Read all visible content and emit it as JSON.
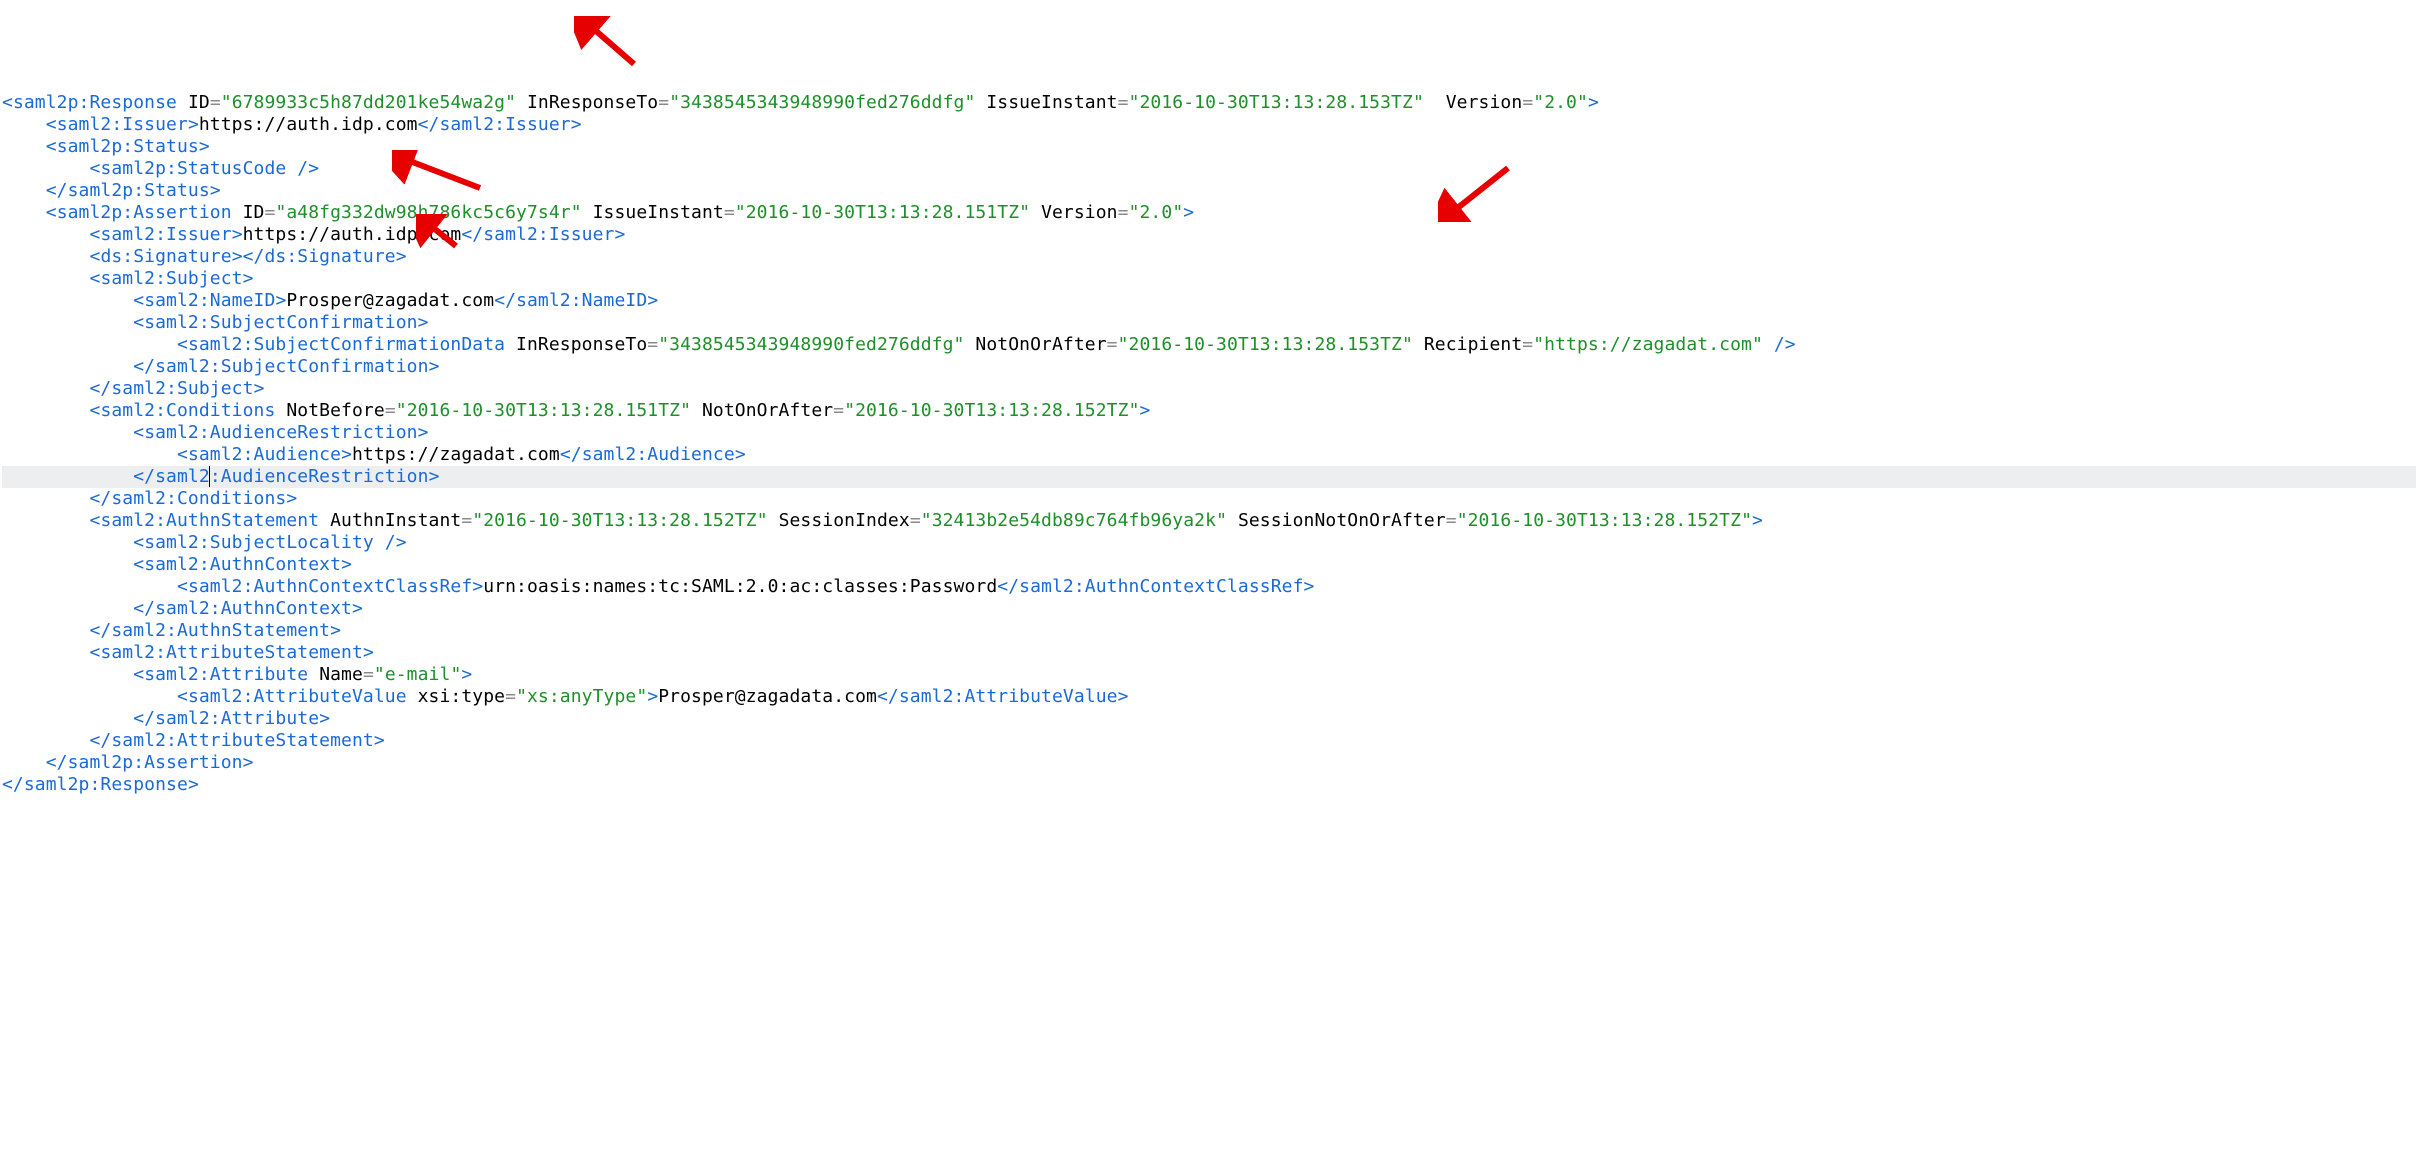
{
  "response": {
    "tag": "saml2p:Response",
    "id": "6789933c5h87dd201ke54wa2g",
    "inResponseTo": "3438545343948990fed276ddfg",
    "issueInstant": "2016-10-30T13:13:28.153TZ",
    "version": "2.0"
  },
  "issuer1": {
    "tag": "saml2:Issuer",
    "text": "https://auth.idp.com"
  },
  "status": {
    "tag": "saml2p:Status",
    "code": "saml2p:StatusCode"
  },
  "assertion": {
    "tag": "saml2p:Assertion",
    "id": "a48fg332dw98h786kc5c6y7s4r",
    "issueInstant": "2016-10-30T13:13:28.151TZ",
    "version": "2.0"
  },
  "issuer2": {
    "tag": "saml2:Issuer",
    "text": "https://auth.idp.com"
  },
  "signature": {
    "tag": "ds:Signature"
  },
  "subject": {
    "tag": "saml2:Subject"
  },
  "nameId": {
    "tag": "saml2:NameID",
    "text": "Prosper@zagadat.com"
  },
  "subjConf": {
    "tag": "saml2:SubjectConfirmation"
  },
  "subjConfData": {
    "tag": "saml2:SubjectConfirmationData",
    "inResponseTo": "3438545343948990fed276ddfg",
    "notOnOrAfter": "2016-10-30T13:13:28.153TZ",
    "recipient": "https://zagadat.com"
  },
  "conditions": {
    "tag": "saml2:Conditions",
    "notBefore": "2016-10-30T13:13:28.151TZ",
    "notOnOrAfter": "2016-10-30T13:13:28.152TZ"
  },
  "audRestr": {
    "tag": "saml2:AudienceRestriction"
  },
  "audience": {
    "tag": "saml2:Audience",
    "text": "https://zagadat.com"
  },
  "audRestrClose": "saml2",
  "audRestrCloseTail": ":AudienceRestriction",
  "authnStmt": {
    "tag": "saml2:AuthnStatement",
    "authnInstant": "2016-10-30T13:13:28.152TZ",
    "sessionIndex": "32413b2e54db89c764fb96ya2k",
    "sessionNotOnOrAfter": "2016-10-30T13:13:28.152TZ"
  },
  "subjLoc": {
    "tag": "saml2:SubjectLocality"
  },
  "authnCtx": {
    "tag": "saml2:AuthnContext"
  },
  "authnCtxClassRef": {
    "tag": "saml2:AuthnContextClassRef",
    "text": "urn:oasis:names:tc:SAML:2.0:ac:classes:Password"
  },
  "attrStmt": {
    "tag": "saml2:AttributeStatement"
  },
  "attribute": {
    "tag": "saml2:Attribute",
    "name": "e-mail"
  },
  "attrValue": {
    "tag": "saml2:AttributeValue",
    "typeAttr": "xsi:type",
    "typeVal": "xs:anyType",
    "text": "Prosper@zagadata.com"
  },
  "labels": {
    "ID": "ID",
    "InResponseTo": "InResponseTo",
    "IssueInstant": "IssueInstant",
    "Version": "Version",
    "NotOnOrAfter": "NotOnOrAfter",
    "Recipient": "Recipient",
    "NotBefore": "NotBefore",
    "AuthnInstant": "AuthnInstant",
    "SessionIndex": "SessionIndex",
    "SessionNotOnOrAfter": "SessionNotOnOrAfter",
    "Name": "Name"
  }
}
